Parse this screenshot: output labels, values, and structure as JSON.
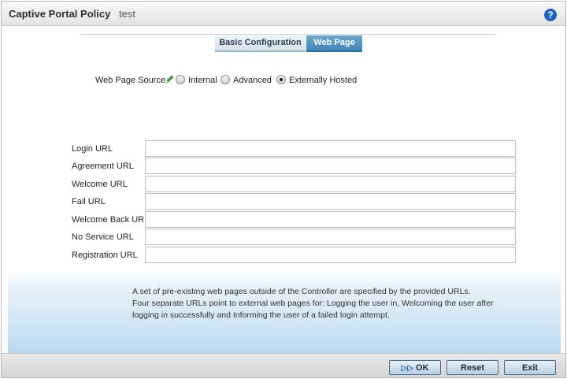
{
  "window": {
    "title": "Captive Portal Policy",
    "subtitle": "test",
    "help_glyph": "?"
  },
  "tabs": [
    {
      "label": "Basic Configuration",
      "active": false
    },
    {
      "label": "Web Page",
      "active": true
    }
  ],
  "web_page_source": {
    "label": "Web Page Source",
    "options": [
      {
        "label": "Internal",
        "selected": false
      },
      {
        "label": "Advanced",
        "selected": false
      },
      {
        "label": "Externally Hosted",
        "selected": true
      }
    ]
  },
  "url_fields": [
    {
      "label": "Login URL",
      "value": ""
    },
    {
      "label": "Agreement URL",
      "value": ""
    },
    {
      "label": "Welcome URL",
      "value": ""
    },
    {
      "label": "Fail URL",
      "value": ""
    },
    {
      "label": "Welcome Back URL",
      "value": ""
    },
    {
      "label": "No Service URL",
      "value": ""
    },
    {
      "label": "Registration URL",
      "value": ""
    }
  ],
  "info_lines": [
    "A set of pre-existing web pages outside of the Controller are specified by the provided URLs.",
    "Four separate URLs point to external web pages for: Logging the user in, Welcoming the user after",
    "logging in successfully and Informing the user of a failed login attempt."
  ],
  "buttons": {
    "ok": "OK",
    "reset": "Reset",
    "exit": "Exit"
  },
  "icons": {
    "help": "help-icon",
    "edit": "pencil-icon",
    "ok": "ok-arrow-icon"
  },
  "colors": {
    "accent": "#1a62c9",
    "active_tab": "#4f93c1",
    "pencil": "#3aa53a"
  }
}
